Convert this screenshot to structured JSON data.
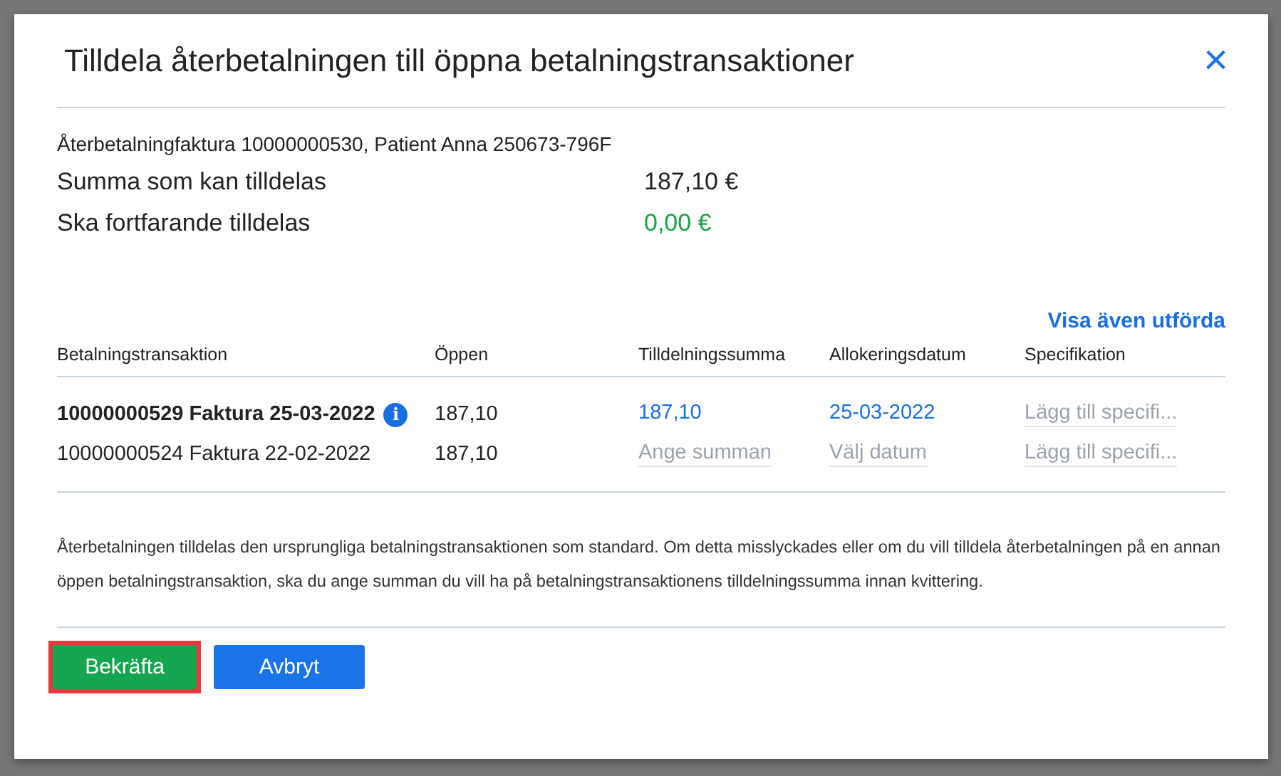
{
  "dialog": {
    "title": "Tilldela återbetalningen till öppna betalningstransaktioner",
    "close": "×"
  },
  "invoice_line": "Återbetalningfaktura 10000000530, Patient Anna 250673-796F",
  "summary": [
    {
      "label": "Summa som kan tilldelas",
      "value": "187,10 €",
      "kind": "plain"
    },
    {
      "label": "Ska fortfarande tilldelas",
      "value": "0,00 €",
      "kind": "positive"
    }
  ],
  "show_completed_link": "Visa även utförda",
  "table": {
    "columns": [
      "Betalningstransaktion",
      "Öppen",
      "Tilldelningssumma",
      "Allokeringsdatum",
      "Specifikation"
    ],
    "rows": [
      {
        "transaction": "10000000529 Faktura 25-03-2022",
        "selected": true,
        "info_icon": "i",
        "open": "187,10",
        "amount": {
          "value": "187,10"
        },
        "date": {
          "value": "25-03-2022"
        },
        "specification": {
          "placeholder": "Lägg till specifi..."
        }
      },
      {
        "transaction": "10000000524 Faktura 22-02-2022",
        "selected": false,
        "open": "187,10",
        "amount": {
          "placeholder": "Ange summan"
        },
        "date": {
          "placeholder": "Välj datum"
        },
        "specification": {
          "placeholder": "Lägg till specifi..."
        }
      }
    ]
  },
  "note": "Återbetalningen tilldelas den ursprungliga betalningstransaktionen som standard. Om detta misslyckades eller om du vill tilldela återbetalningen på en annan öppen betalningstransaktion, ska du ange summan du vill ha på betalningstransaktionens tilldelningssumma innan kvittering.",
  "buttons": [
    {
      "label": "Bekräfta",
      "kind": "confirm",
      "highlighted": true
    },
    {
      "label": "Avbryt",
      "kind": "cancel",
      "highlighted": false
    }
  ]
}
